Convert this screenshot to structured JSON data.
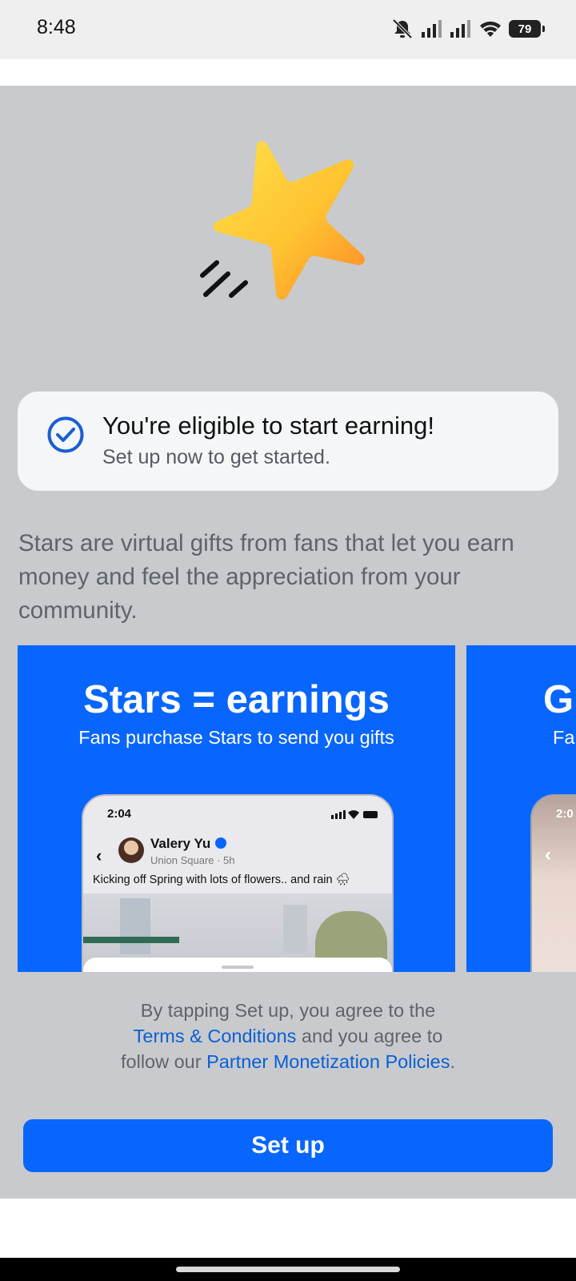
{
  "status_bar": {
    "time": "8:48",
    "battery": "79",
    "icons": [
      "mute-icon",
      "signal-icon",
      "signal-icon",
      "wifi-icon",
      "battery-icon"
    ]
  },
  "hero": {
    "icon": "shooting-star-icon"
  },
  "eligible": {
    "icon": "check-circle-icon",
    "title": "You're eligible to start earning!",
    "subtitle": "Set up now to get started."
  },
  "description": "Stars are virtual gifts from fans that let you earn money and feel the appreciation from your community.",
  "carousel": {
    "cards": [
      {
        "title": "Stars = earnings",
        "subtitle": "Fans purchase Stars to send you gifts",
        "phone": {
          "time": "2:04",
          "name": "Valery Yu",
          "location": "Union Square · 5h",
          "post": "Kicking off Spring with lots of flowers.. and rain 🌧"
        }
      },
      {
        "title": "G",
        "subtitle": "Fa",
        "phone": {
          "time": "2:0"
        }
      }
    ]
  },
  "terms": {
    "prefix": "By tapping Set up, you agree to the",
    "link1": "Terms & Conditions",
    "middle": " and you agree to follow our ",
    "link2": "Partner Monetization Policies",
    "suffix": "."
  },
  "setup_button": "Set up",
  "colors": {
    "brand_blue": "#0866ff",
    "link_blue": "#0a5fd6",
    "sheet_gray": "#c8cacd"
  }
}
